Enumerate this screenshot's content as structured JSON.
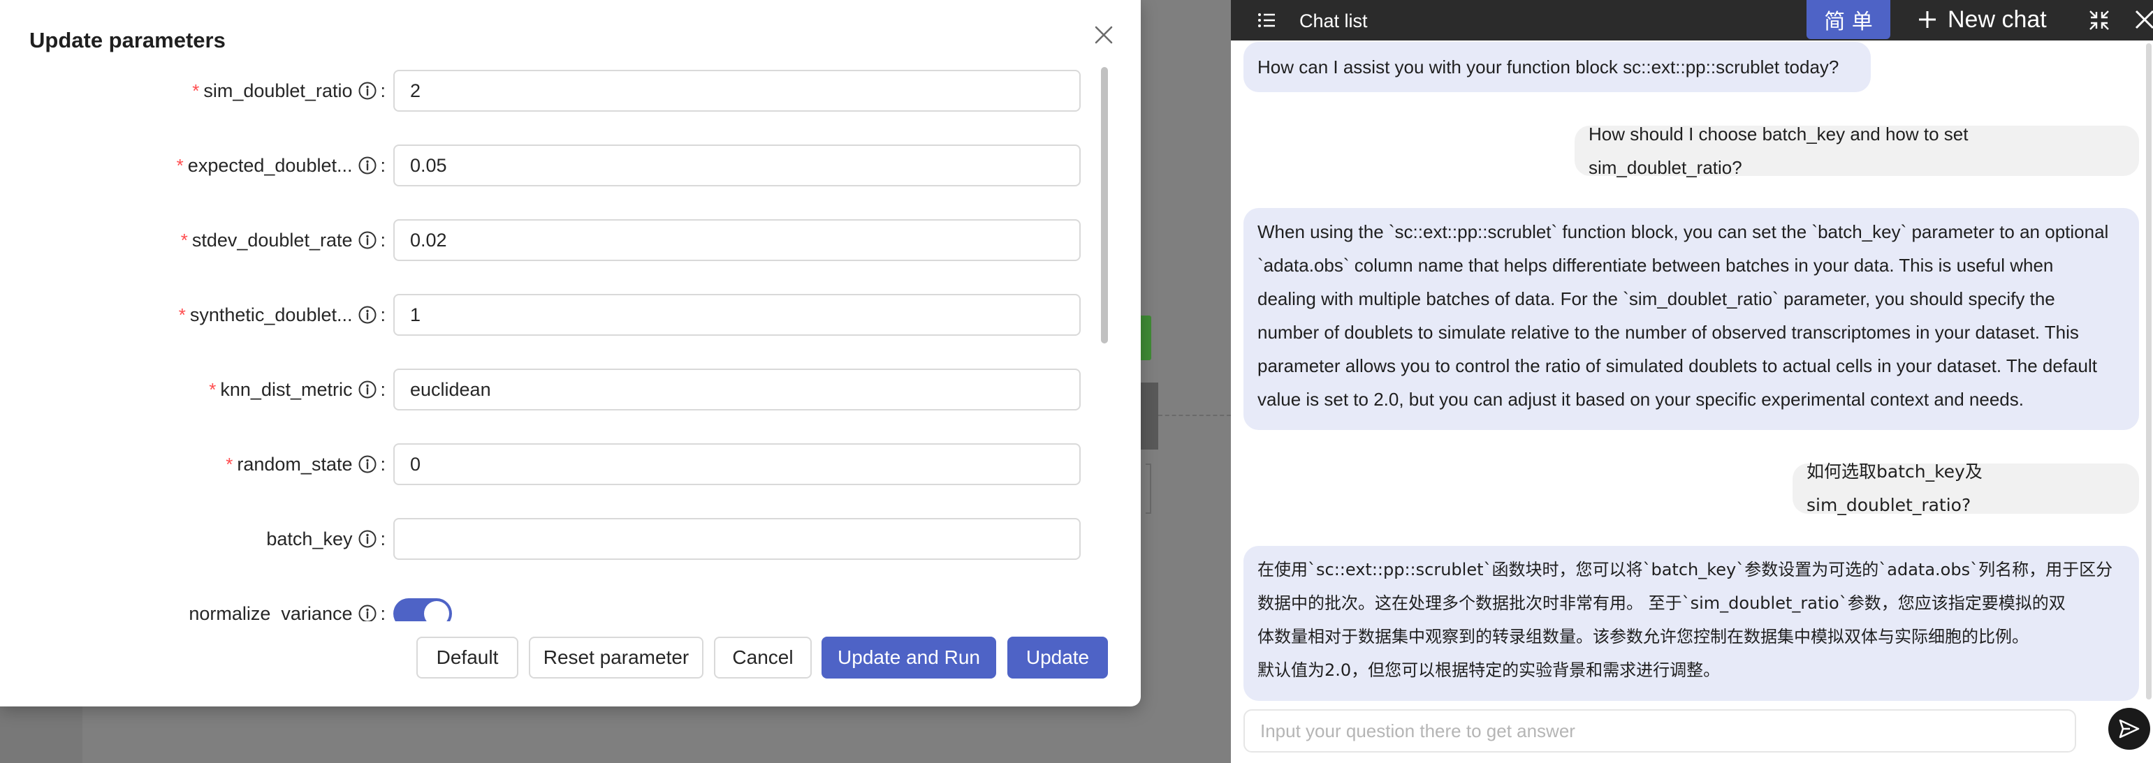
{
  "modal": {
    "title": "Update parameters",
    "fields": [
      {
        "label": "sim_doublet_ratio",
        "required": true,
        "value": "2"
      },
      {
        "label": "expected_doublet...",
        "required": true,
        "value": "0.05"
      },
      {
        "label": "stdev_doublet_rate",
        "required": true,
        "value": "0.02"
      },
      {
        "label": "synthetic_doublet...",
        "required": true,
        "value": "1"
      },
      {
        "label": "knn_dist_metric",
        "required": true,
        "value": "euclidean"
      },
      {
        "label": "random_state",
        "required": true,
        "value": "0"
      },
      {
        "label": "batch_key",
        "required": false,
        "value": ""
      },
      {
        "label": "normalize_variance",
        "required": false,
        "toggle": true,
        "on": true
      }
    ],
    "required_mark": "*",
    "colon": ":",
    "buttons": {
      "default": "Default",
      "reset": "Reset parameter",
      "cancel": "Cancel",
      "update_run": "Update and Run",
      "update": "Update"
    }
  },
  "chat": {
    "header": {
      "list_title": "Chat list",
      "lang_toggle": "简 单",
      "new_chat": "New chat"
    },
    "messages": [
      {
        "role": "assistant",
        "text": "How can I assist you with your function block sc::ext::pp::scrublet today?"
      },
      {
        "role": "user",
        "text": "How should I choose batch_key and how to set sim_doublet_ratio?"
      },
      {
        "role": "assistant",
        "lines": [
          "When using the `sc::ext::pp::scrublet` function block, you can set the `batch_key` parameter to an optional",
          "`adata.obs` column name that helps differentiate between batches in your data. This is useful when",
          "dealing with multiple batches of data. For the `sim_doublet_ratio` parameter, you should specify the",
          "number of doublets to simulate relative to the number of observed transcriptomes in your dataset. This",
          "parameter allows you to control the ratio of simulated doublets to actual cells in your dataset. The default",
          "value is set to 2.0, but you can adjust it based on your specific experimental context and needs."
        ]
      },
      {
        "role": "user",
        "text": "如何选取batch_key及sim_doublet_ratio?"
      },
      {
        "role": "assistant",
        "lines": [
          "在使用`sc::ext::pp::scrublet`函数块时，您可以将`batch_key`参数设置为可选的`adata.obs`列名称，用于区分",
          "数据中的批次。这在处理多个数据批次时非常有用。 至于`sim_doublet_ratio`参数，您应该指定要模拟的双",
          "体数量相对于数据集中观察到的转录组数量。该参数允许您控制在数据集中模拟双体与实际细胞的比例。",
          "默认值为2.0，但您可以根据特定的实验背景和需求进行调整。"
        ]
      }
    ],
    "input": {
      "placeholder": "Input your question there to get answer",
      "value": ""
    }
  },
  "colors": {
    "primary": "#4e63c6",
    "required": "#ff4d4f",
    "chat_header": "#2b2b2b",
    "assistant_bubble": "#e7eaf8",
    "user_bubble": "#f1f1f1"
  }
}
